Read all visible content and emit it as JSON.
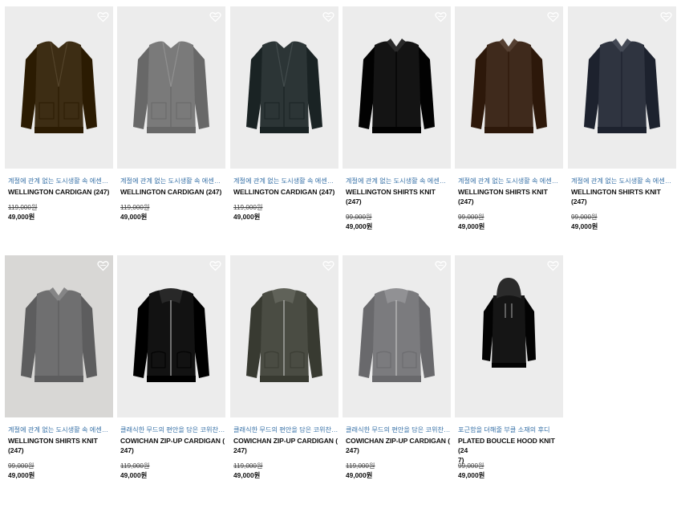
{
  "products": [
    {
      "desc": "계절에 관계 없는 도시생활 속 에센셜 ...",
      "name": "WELLINGTON CARDIGAN (247)",
      "orig": "119,000원",
      "sale": "49,000원",
      "color": "#3d2d14",
      "style": "cardigan",
      "icon": "heart-outline-icon"
    },
    {
      "desc": "계절에 관계 없는 도시생활 속 에센셜 ...",
      "name": "WELLINGTON CARDIGAN (247)",
      "orig": "119,000원",
      "sale": "49,000원",
      "color": "#7a7a7a",
      "style": "cardigan",
      "icon": "heart-outline-icon"
    },
    {
      "desc": "계절에 관계 없는 도시생활 속 에센셜 ...",
      "name": "WELLINGTON CARDIGAN (247)",
      "orig": "119,000원",
      "sale": "49,000원",
      "color": "#2c3536",
      "style": "cardigan",
      "icon": "heart-outline-icon"
    },
    {
      "desc": "계절에 관계 없는 도시생활 속 에센셜 ...",
      "name": "WELLINGTON SHIRTS KNIT (247)",
      "orig": "99,000원",
      "sale": "49,000원",
      "color": "#141414",
      "style": "shirt",
      "icon": "heart-outline-icon"
    },
    {
      "desc": "계절에 관계 없는 도시생활 속 에센셜 ...",
      "name": "WELLINGTON SHIRTS KNIT (247)",
      "orig": "99,000원",
      "sale": "49,000원",
      "color": "#3f2a1c",
      "style": "shirt",
      "icon": "heart-outline-icon"
    },
    {
      "desc": "계절에 관계 없는 도시생활 속 에센셜 ...",
      "name": "WELLINGTON SHIRTS KNIT (247)",
      "orig": "99,000원",
      "sale": "49,000원",
      "color": "#2f3440",
      "style": "shirt",
      "icon": "heart-outline-icon"
    },
    {
      "desc": "계절에 관계 없는 도시생활 속 에센셜 ...",
      "name": "WELLINGTON SHIRTS KNIT (247)",
      "orig": "99,000원",
      "sale": "49,000원",
      "color": "#6f6f70",
      "style": "shirt",
      "icon": "heart-outline-icon"
    },
    {
      "desc": "클래식한 무드의 편안을 담은 코위찬 가...",
      "name": "COWICHAN ZIP-UP CARDIGAN (\n247)",
      "orig": "119,000원",
      "sale": "49,000원",
      "color": "#121212",
      "style": "zip",
      "icon": "heart-outline-icon"
    },
    {
      "desc": "클래식한 무드의 편안을 담은 코위찬 가...",
      "name": "COWICHAN ZIP-UP CARDIGAN (\n247)",
      "orig": "119,000원",
      "sale": "49,000원",
      "color": "#4a4c43",
      "style": "zip",
      "icon": "heart-outline-icon"
    },
    {
      "desc": "클래식한 무드의 편안을 담은 코위찬 가...",
      "name": "COWICHAN ZIP-UP CARDIGAN (\n247)",
      "orig": "119,000원",
      "sale": "49,000원",
      "color": "#7b7b7e",
      "style": "zip",
      "icon": "heart-outline-icon"
    },
    {
      "desc": "포근함을 더해줄 부클 소재의 후디",
      "name": "PLATED BOUCLE HOOD KNIT (24\n7)",
      "orig": "99,000원",
      "sale": "49,000원",
      "color": "#151515",
      "style": "hood",
      "icon": "heart-outline-icon"
    }
  ]
}
